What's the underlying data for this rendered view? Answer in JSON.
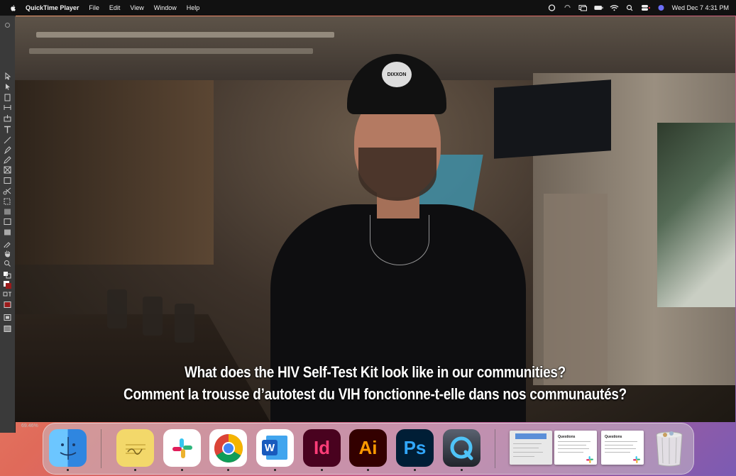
{
  "menubar": {
    "app_name": "QuickTime Player",
    "menus": [
      "File",
      "Edit",
      "View",
      "Window",
      "Help"
    ],
    "clock": "Wed Dec 7  4:31 PM"
  },
  "illustrator": {
    "zoom": "69.46%"
  },
  "video": {
    "cap_text": "DIXXON",
    "subtitles": [
      "What does the HIV Self-Test Kit look like in our communities?",
      "Comment la trousse d’autotest du VIH fonctionne-t-elle dans nos communautés?"
    ]
  },
  "dock": {
    "apps": [
      {
        "name": "finder-icon",
        "letters": "",
        "bg": "#4aa8ef",
        "fg": "#ffffff"
      },
      {
        "name": "stickies-icon",
        "letters": "",
        "bg": "#f3d86a",
        "fg": "#7a6420"
      },
      {
        "name": "slack-icon",
        "letters": "",
        "bg": "#ffffff",
        "fg": "#4a154b"
      },
      {
        "name": "chrome-icon",
        "letters": "",
        "bg": "#ffffff",
        "fg": "#000000"
      },
      {
        "name": "word-icon",
        "letters": "W",
        "bg": "#ffffff",
        "fg": "#2b5fb6"
      },
      {
        "name": "indesign-icon",
        "letters": "Id",
        "bg": "#49021f",
        "fg": "#ff3d78"
      },
      {
        "name": "illustrator-icon",
        "letters": "Ai",
        "bg": "#330000",
        "fg": "#ff9a00"
      },
      {
        "name": "photoshop-icon",
        "letters": "Ps",
        "bg": "#001e36",
        "fg": "#31a8ff"
      },
      {
        "name": "quicktime-icon",
        "letters": "Q",
        "bg": "#2a2f38",
        "fg": "#4fc3f7"
      }
    ],
    "docs": [
      {
        "title": ""
      },
      {
        "title": "Questions"
      },
      {
        "title": "Questions"
      }
    ]
  }
}
